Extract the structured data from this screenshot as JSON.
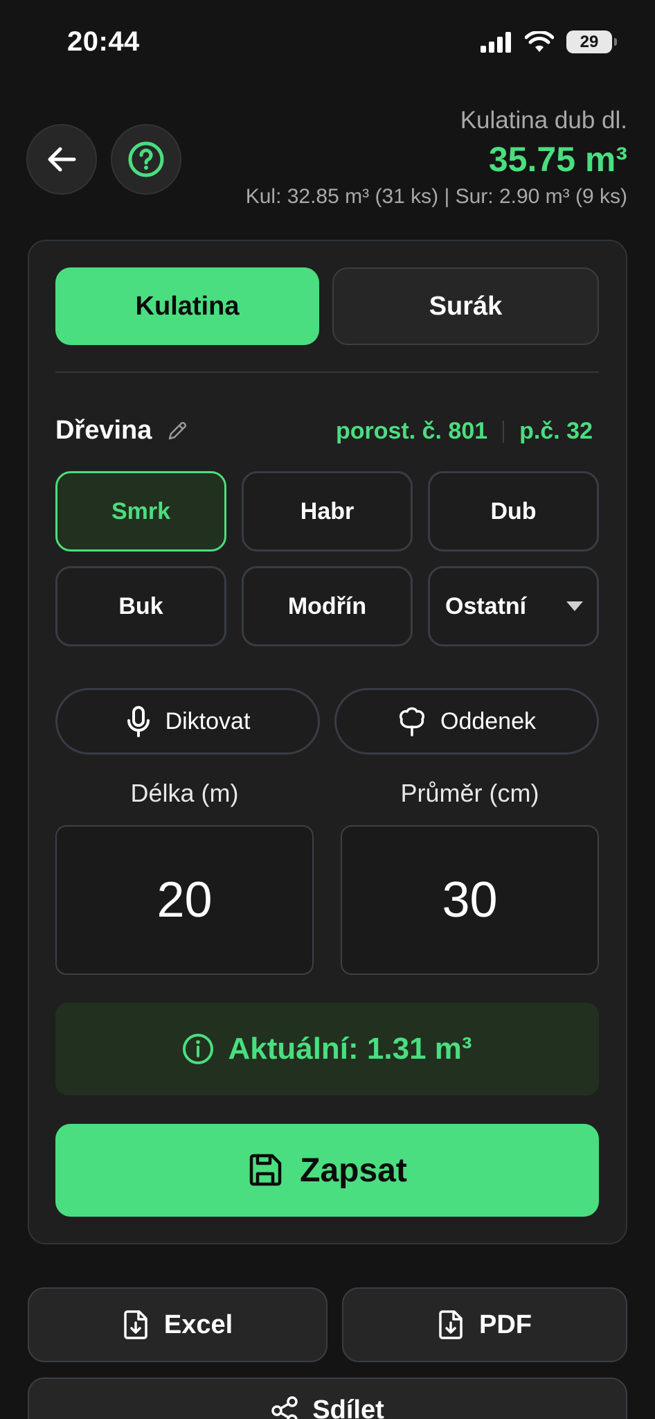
{
  "status_bar": {
    "time": "20:44",
    "battery": "29"
  },
  "header": {
    "title": "Kulatina dub dl.",
    "volume": "35.75 m³",
    "summary": "Kul: 32.85 m³ (31 ks) | Sur: 2.90 m³ (9 ks)"
  },
  "mode_tabs": [
    {
      "label": "Kulatina",
      "active": true
    },
    {
      "label": "Surák",
      "active": false
    }
  ],
  "species": {
    "label": "Dřevina",
    "plot": "porost. č. 801",
    "parcel": "p.č. 32",
    "options": [
      {
        "label": "Smrk",
        "active": true
      },
      {
        "label": "Habr",
        "active": false
      },
      {
        "label": "Dub",
        "active": false
      },
      {
        "label": "Buk",
        "active": false
      },
      {
        "label": "Modřín",
        "active": false
      }
    ],
    "other_select": "Ostatní"
  },
  "actions": {
    "dictate": "Diktovat",
    "butt_log": "Oddenek"
  },
  "inputs": {
    "length_label": "Délka (m)",
    "length_value": "20",
    "diameter_label": "Průměr (cm)",
    "diameter_value": "30"
  },
  "current": {
    "text": "Aktuální: 1.31 m³"
  },
  "save": {
    "label": "Zapsat"
  },
  "export": {
    "excel": "Excel",
    "pdf": "PDF",
    "share": "Sdílet"
  },
  "colors": {
    "accent": "#4ade80",
    "background": "#141414",
    "card": "#1f1f1f"
  }
}
